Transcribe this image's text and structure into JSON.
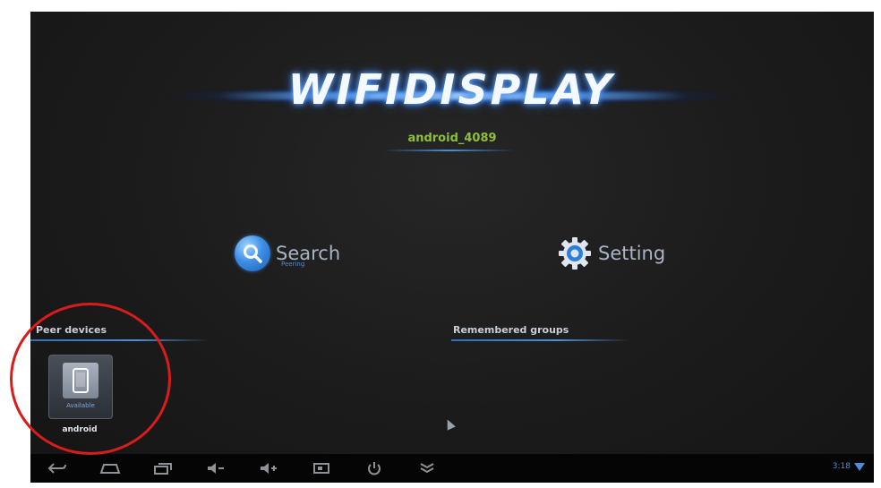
{
  "app": {
    "logo_text": "WIFIDISPLAY",
    "device_name": "android_4089"
  },
  "actions": {
    "search_label": "Search",
    "search_sub": "Peering",
    "setting_label": "Setting"
  },
  "sections": {
    "peer_devices_title": "Peer devices",
    "remembered_groups_title": "Remembered groups"
  },
  "peer_devices": [
    {
      "status": "Available",
      "label": "android"
    }
  ],
  "navbar": {
    "buttons": [
      "back-icon",
      "home-icon",
      "recent-apps-icon",
      "volume-down-icon",
      "volume-up-icon",
      "screenshot-icon",
      "power-icon",
      "menu-icon"
    ],
    "clock": "3:18"
  },
  "colors": {
    "accent": "#4a8fd8",
    "device_name": "#8fbf3a",
    "highlight_circle": "#d81c1c"
  }
}
